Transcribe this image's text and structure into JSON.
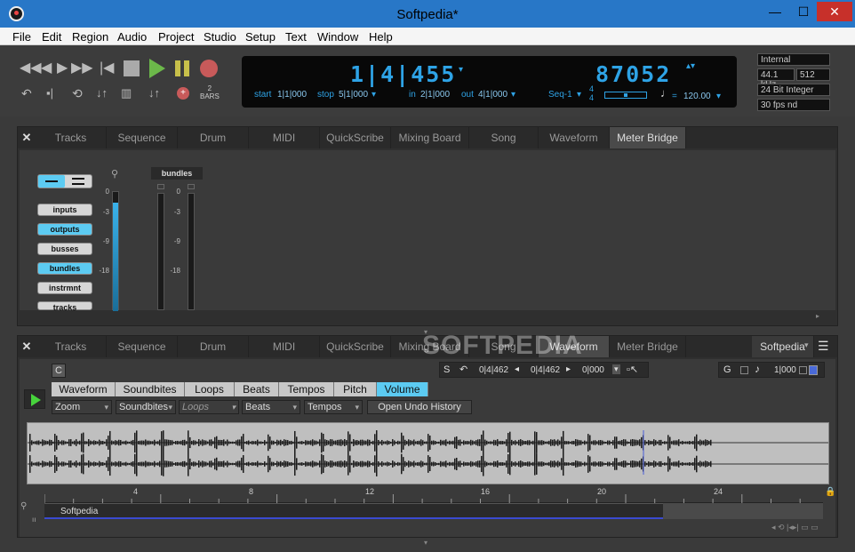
{
  "window": {
    "title": "Softpedia*",
    "min": "—",
    "max": "☐",
    "close": "✕"
  },
  "menu": [
    "File",
    "Edit",
    "Region",
    "Audio",
    "Project",
    "Studio",
    "Setup",
    "Text",
    "Window",
    "Help"
  ],
  "counter": {
    "bars": "1|4|455",
    "samples": "87052",
    "start_label": "start",
    "start_val": "1|1|000",
    "stop_label": "stop",
    "stop_val": "5|1|000",
    "in_label": "in",
    "in_val": "2|1|000",
    "out_label": "out",
    "out_val": "4|1|000",
    "seq": "Seq-1",
    "meter_top": "4",
    "meter_bot": "4",
    "tempo_eq": "=",
    "tempo": "120.00"
  },
  "bars_label": "2\nBARS",
  "sync": {
    "source": "Internal",
    "rate": "44.1 kHz",
    "buffer": "512",
    "format": "24 Bit Integer",
    "fps": "30 fps nd"
  },
  "top_tabs": [
    "Tracks",
    "Sequence",
    "Drum",
    "MIDI",
    "QuickScribe",
    "Mixing Board",
    "Song",
    "Waveform",
    "Meter Bridge"
  ],
  "top_active": "Meter Bridge",
  "close_glyph": "✕",
  "meter_buttons": [
    {
      "label": "inputs",
      "on": false
    },
    {
      "label": "outputs",
      "on": true
    },
    {
      "label": "busses",
      "on": false
    },
    {
      "label": "bundles",
      "on": true
    },
    {
      "label": "instrmnt",
      "on": false
    },
    {
      "label": "tracks",
      "on": false
    }
  ],
  "meter_scale": [
    "0",
    "-3",
    "-9",
    "-18"
  ],
  "bundles_label": "bundles",
  "bottom_tabs": [
    "Tracks",
    "Sequence",
    "Drum",
    "MIDI",
    "QuickScribe",
    "Mixing Board",
    "Song",
    "Waveform",
    "Meter Bridge"
  ],
  "bottom_active": "Waveform",
  "bottom_right_dd": "Softpedia",
  "c_btn": "C",
  "s_btn": "S",
  "edit_range": {
    "start": "0|4|462",
    "end": "0|4|462",
    "len": "0|000"
  },
  "g_btn": "G",
  "grid_val": "1|000",
  "wave_tabs": [
    "Waveform",
    "Soundbites",
    "Loops",
    "Beats",
    "Tempos",
    "Pitch",
    "Volume"
  ],
  "wave_active": "Volume",
  "wave_dropdowns": [
    "Zoom",
    "Soundbites",
    "Loops",
    "Beats",
    "Tempos"
  ],
  "undo_btn": "Open Undo History",
  "ruler_ticks": [
    "4",
    "8",
    "12",
    "16",
    "20",
    "24"
  ],
  "region_name": "Softpedia",
  "watermark": "SOFTPEDIA",
  "colors": {
    "accent": "#2ea3e6",
    "button_on": "#5ccbf2",
    "titlebar": "#2877c7"
  }
}
